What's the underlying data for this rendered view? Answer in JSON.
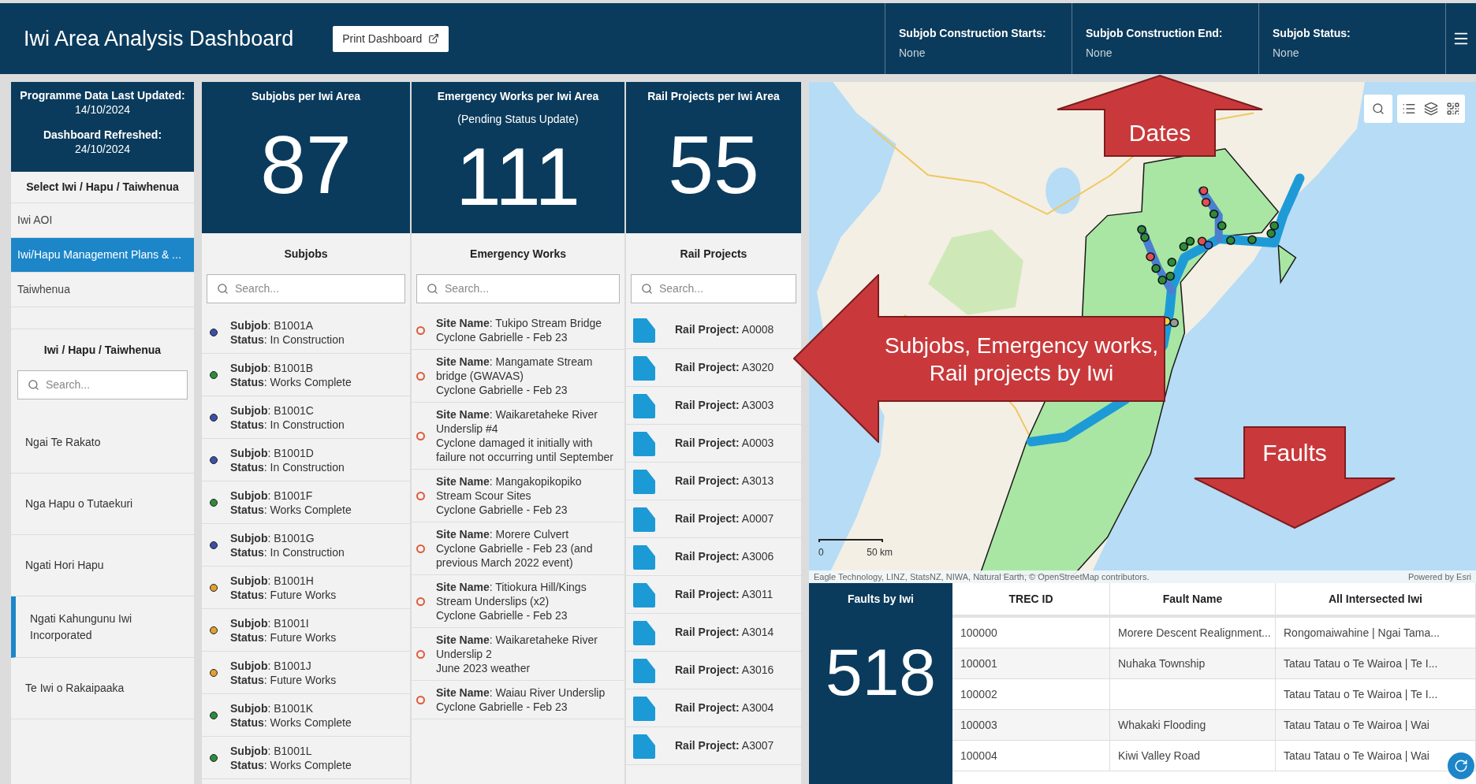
{
  "header": {
    "title": "Iwi Area Analysis Dashboard",
    "print_button": "Print Dashboard",
    "filters": [
      {
        "label": "Subjob Construction Starts:",
        "value": "None"
      },
      {
        "label": "Subjob Construction End:",
        "value": "None"
      },
      {
        "label": "Subjob Status:",
        "value": "None"
      }
    ]
  },
  "sidebar": {
    "info": [
      {
        "label": "Programme Data Last Updated:",
        "value": "14/10/2024"
      },
      {
        "label": "Dashboard Refreshed:",
        "value": "24/10/2024"
      }
    ],
    "select_title": "Select Iwi / Hapu / Taiwhenua",
    "select_items": [
      {
        "label": "Iwi AOI",
        "selected": false
      },
      {
        "label": "Iwi/Hapu Management Plans & ...",
        "selected": true
      },
      {
        "label": "Taiwhenua",
        "selected": false
      }
    ],
    "list_title": "Iwi / Hapu / Taiwhenua",
    "search": {
      "placeholder": "Search..."
    },
    "list_items": [
      {
        "label": "Ngai Te Rakato",
        "selected": false
      },
      {
        "label": "Nga Hapu o Tutaekuri",
        "selected": false
      },
      {
        "label": "Ngati Hori Hapu",
        "selected": false
      },
      {
        "label": "Ngati Kahungunu Iwi Incorporated",
        "selected": true
      },
      {
        "label": "Te Iwi o Rakaipaaka",
        "selected": false
      }
    ]
  },
  "subjobs": {
    "kpi_title": "Subjobs per Iwi Area",
    "kpi_value": "87",
    "list_title": "Subjobs",
    "search": {
      "placeholder": "Search..."
    },
    "items": [
      {
        "line1": "**Subjob**: B1001A",
        "line2": "**Status**: In Construction",
        "color": "#3b4fa8"
      },
      {
        "line1": "**Subjob**: B1001B",
        "line2": "**Status**: Works Complete",
        "color": "#2e8b3a"
      },
      {
        "line1": "**Subjob**: B1001C",
        "line2": "**Status**: In Construction",
        "color": "#3b4fa8"
      },
      {
        "line1": "**Subjob**: B1001D",
        "line2": "**Status**: In Construction",
        "color": "#3b4fa8"
      },
      {
        "line1": "**Subjob**: B1001F",
        "line2": "**Status**: Works Complete",
        "color": "#2e8b3a"
      },
      {
        "line1": "**Subjob**: B1001G",
        "line2": "**Status**: In Construction",
        "color": "#3b4fa8"
      },
      {
        "line1": "**Subjob**: B1001H",
        "line2": "**Status**: Future Works",
        "color": "#e0a030"
      },
      {
        "line1": "**Subjob**: B1001I",
        "line2": "**Status**: Future Works",
        "color": "#e0a030"
      },
      {
        "line1": "**Subjob**: B1001J",
        "line2": "**Status**: Future Works",
        "color": "#e0a030"
      },
      {
        "line1": "**Subjob**: B1001K",
        "line2": "**Status**: Works Complete",
        "color": "#2e8b3a"
      },
      {
        "line1": "**Subjob**: B1001L",
        "line2": "**Status**: Works Complete",
        "color": "#2e8b3a"
      }
    ]
  },
  "emergency": {
    "kpi_title": "Emergency Works per Iwi Area",
    "kpi_subtitle": "(Pending Status Update)",
    "kpi_value": "111",
    "list_title": "Emergency Works",
    "search": {
      "placeholder": "Search..."
    },
    "items": [
      {
        "site": "**Site Name**: Tukipo Stream Bridge",
        "note": "Cyclone Gabrielle - Feb 23"
      },
      {
        "site": "**Site Name**: Mangamate Stream bridge (GWAVAS)",
        "note": "Cyclone Gabrielle - Feb 23"
      },
      {
        "site": "**Site Name**: Waikaretaheke River Underslip #4",
        "note": "Cyclone damaged it initially with failure not occurring until September"
      },
      {
        "site": "**Site Name**: Mangakopikopiko Stream Scour Sites",
        "note": "Cyclone Gabrielle - Feb 23"
      },
      {
        "site": "**Site Name**: Morere Culvert",
        "note": "Cyclone Gabrielle - Feb 23 (and previous March 2022 event)"
      },
      {
        "site": "**Site Name**: Titiokura Hill/Kings Stream Underslips (x2)",
        "note": "Cyclone Gabrielle - Feb 23"
      },
      {
        "site": "**Site Name**: Waikaretaheke River Underslip 2",
        "note": "June 2023 weather"
      },
      {
        "site": "**Site Name**: Waiau River Underslip",
        "note": "Cyclone Gabrielle - Feb 23"
      }
    ]
  },
  "rail": {
    "kpi_title": "Rail Projects per Iwi Area",
    "kpi_value": "55",
    "list_title": "Rail Projects",
    "search": {
      "placeholder": "Search..."
    },
    "items": [
      "**Rail Project:** A0008",
      "**Rail Project:** A3020",
      "**Rail Project:** A3003",
      "**Rail Project:** A0003",
      "**Rail Project:** A3013",
      "**Rail Project:** A0007",
      "**Rail Project:** A3006",
      "**Rail Project:** A3011",
      "**Rail Project:** A3014",
      "**Rail Project:** A3016",
      "**Rail Project:** A3004",
      "**Rail Project:** A3007"
    ]
  },
  "map": {
    "scale_start": "0",
    "scale_end": "50 km",
    "attribution": "Eagle Technology, LINZ, StatsNZ, NIWA, Natural Earth, © OpenStreetMap contributors.",
    "powered_by": "Powered by Esri"
  },
  "faults": {
    "kpi_title": "Faults by Iwi",
    "kpi_value": "518",
    "table": {
      "columns": [
        "TREC ID",
        "Fault Name",
        "All Intersected Iwi"
      ],
      "rows": [
        [
          "100000",
          "Morere Descent Realignment...",
          "Rongomaiwahine | Ngai Tama..."
        ],
        [
          "100001",
          "Nuhaka Township",
          "Tatau Tatau o Te Wairoa | Te I..."
        ],
        [
          "100002",
          "",
          "Tatau Tatau o Te Wairoa | Te I..."
        ],
        [
          "100003",
          "Whakaki Flooding",
          "Tatau Tatau o Te Wairoa | Wai"
        ],
        [
          "100004",
          "Kiwi Valley Road",
          "Tatau Tatau o Te Wairoa | Wai"
        ]
      ]
    }
  },
  "annotations": [
    {
      "kind": "up",
      "text": "Dates"
    },
    {
      "kind": "left",
      "text": "Subjobs, Emergency works, Rail projects by Iwi"
    },
    {
      "kind": "down",
      "text": "Faults"
    }
  ]
}
